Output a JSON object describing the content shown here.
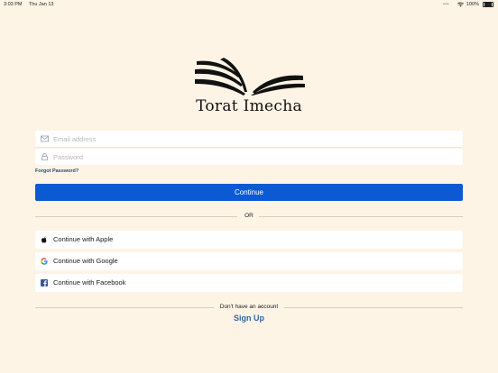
{
  "status_bar": {
    "time": "3:03 PM",
    "date": "Thu Jan 13",
    "dots": "•••",
    "battery": "100%"
  },
  "brand": {
    "name": "Torat Imecha"
  },
  "login": {
    "email_placeholder": "Email address",
    "email_value": "",
    "password_placeholder": "Password",
    "password_value": "",
    "forgot_label": "Forgot Password?",
    "continue_label": "Continue",
    "or_label": "OR"
  },
  "social": {
    "apple_label": "Continue with Apple",
    "google_label": "Continue with Google",
    "facebook_label": "Continue with Facebook"
  },
  "signup": {
    "prompt": "Don't have an account",
    "link_label": "Sign Up"
  },
  "colors": {
    "background": "#fdf4e6",
    "primary": "#0b5ad4",
    "link": "#2f66a8",
    "facebook": "#3b5998"
  },
  "icons": {
    "email": "envelope-icon",
    "password": "lock-icon",
    "apple": "apple-icon",
    "google": "google-icon",
    "facebook": "facebook-icon",
    "logo": "open-book-icon"
  }
}
